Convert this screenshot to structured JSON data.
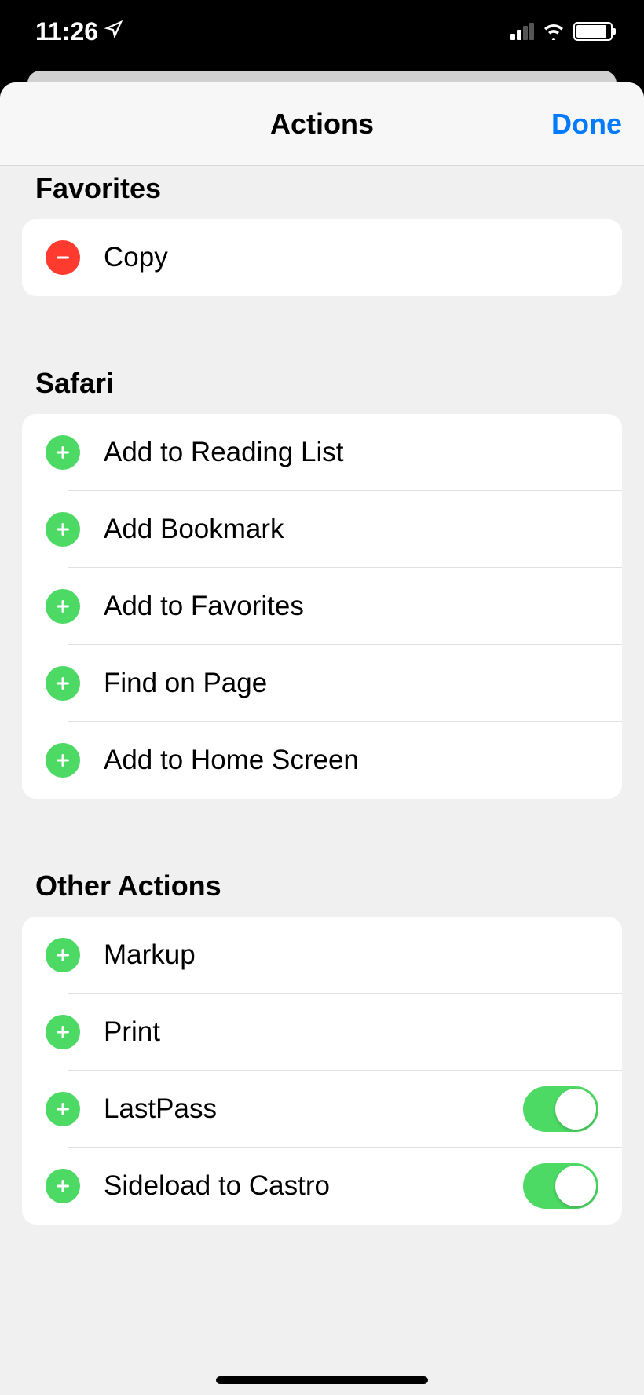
{
  "status": {
    "time": "11:26"
  },
  "header": {
    "title": "Actions",
    "done": "Done"
  },
  "sections": {
    "favorites": {
      "title": "Favorites",
      "items": [
        {
          "label": "Copy",
          "mode": "remove"
        }
      ]
    },
    "safari": {
      "title": "Safari",
      "items": [
        {
          "label": "Add to Reading List",
          "mode": "add"
        },
        {
          "label": "Add Bookmark",
          "mode": "add"
        },
        {
          "label": "Add to Favorites",
          "mode": "add"
        },
        {
          "label": "Find on Page",
          "mode": "add"
        },
        {
          "label": "Add to Home Screen",
          "mode": "add"
        }
      ]
    },
    "other": {
      "title": "Other Actions",
      "items": [
        {
          "label": "Markup",
          "mode": "add",
          "toggle": false
        },
        {
          "label": "Print",
          "mode": "add",
          "toggle": false
        },
        {
          "label": "LastPass",
          "mode": "add",
          "toggle": true
        },
        {
          "label": "Sideload to Castro",
          "mode": "add",
          "toggle": true
        }
      ]
    }
  }
}
